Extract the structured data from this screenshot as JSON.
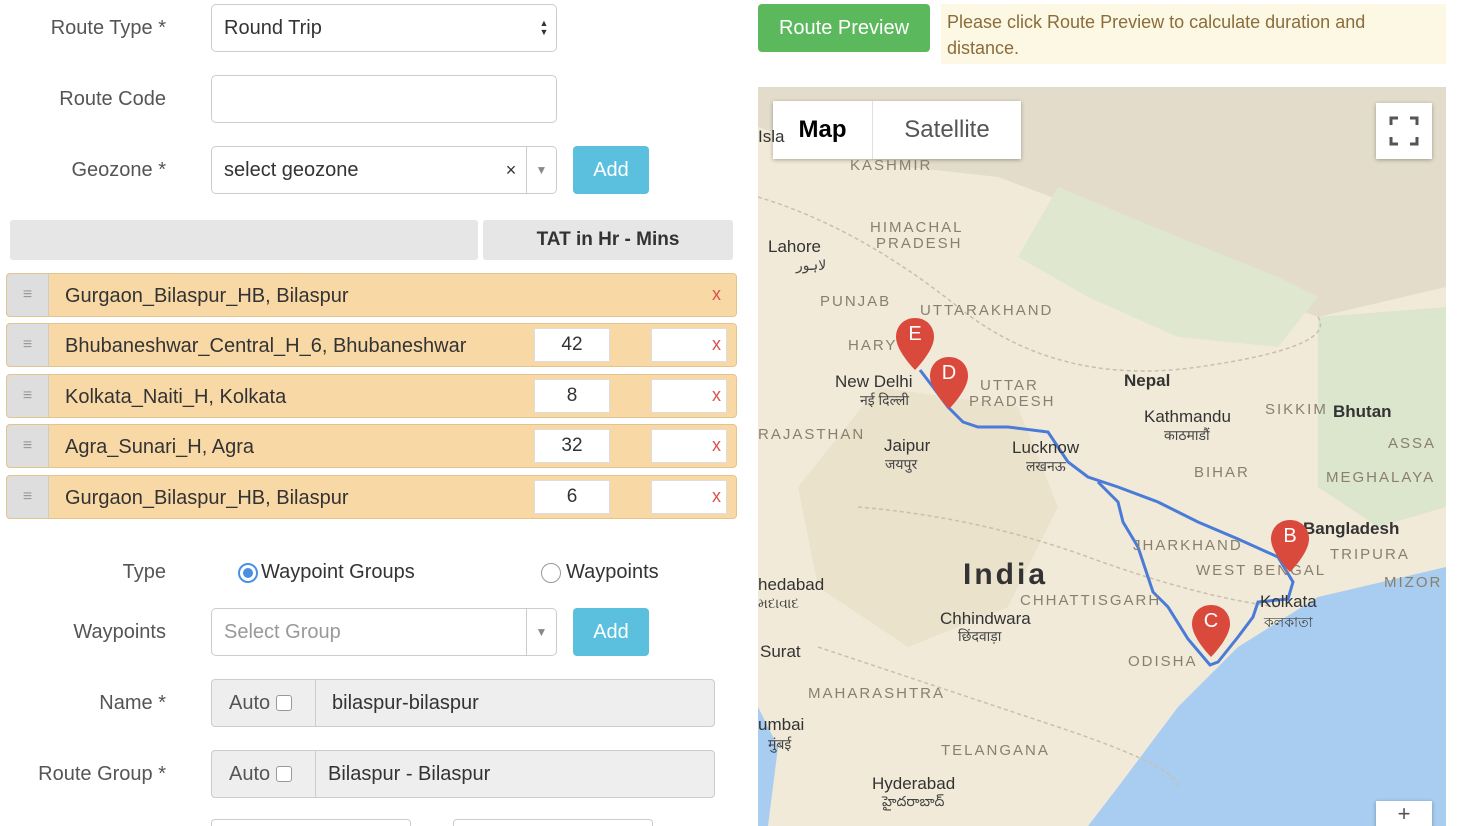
{
  "form": {
    "route_type": {
      "label": "Route Type *",
      "value": "Round Trip"
    },
    "route_code": {
      "label": "Route Code",
      "value": ""
    },
    "geozone": {
      "label": "Geozone *",
      "placeholder": "select geozone",
      "clear": "×",
      "add_label": "Add"
    },
    "table_header": {
      "tat_label": "TAT in Hr - Mins"
    },
    "waypoint_rows": [
      {
        "name": "Gurgaon_Bilaspur_HB, Bilaspur",
        "tat_hr": "",
        "remove": "x"
      },
      {
        "name": "Bhubaneshwar_Central_H_6, Bhubaneshwar",
        "tat_hr": "42",
        "remove": "x"
      },
      {
        "name": "Kolkata_Naiti_H, Kolkata",
        "tat_hr": "8",
        "remove": "x"
      },
      {
        "name": "Agra_Sunari_H, Agra",
        "tat_hr": "32",
        "remove": "x"
      },
      {
        "name": "Gurgaon_Bilaspur_HB, Bilaspur",
        "tat_hr": "6",
        "remove": "x"
      }
    ],
    "type": {
      "label": "Type",
      "options": [
        "Waypoint Groups",
        "Waypoints"
      ],
      "selected": "Waypoint Groups"
    },
    "waypoints": {
      "label": "Waypoints",
      "placeholder": "Select Group",
      "add_label": "Add"
    },
    "name": {
      "label": "Name *",
      "auto_label": "Auto",
      "value": "bilaspur-bilaspur"
    },
    "route_group": {
      "label": "Route Group *",
      "auto_label": "Auto",
      "value": "Bilaspur - Bilaspur"
    }
  },
  "route_preview": {
    "button_label": "Route Preview",
    "notice": "Please click Route Preview to calculate duration and distance."
  },
  "map": {
    "tabs": [
      "Map",
      "Satellite"
    ],
    "active_tab": "Map",
    "markers": [
      "E",
      "D",
      "B",
      "C"
    ],
    "labels": {
      "kashmir": "KASHMIR",
      "himachal1": "HIMACHAL",
      "himachal2": "PRADESH",
      "lahore": "Lahore",
      "lahore_local": "لاہور",
      "punjab": "PUNJAB",
      "uttarakhand": "UTTARAKHAND",
      "haryana": "HARY",
      "new_delhi": "New Delhi",
      "new_delhi_local": "नई दिल्ली",
      "uttar1": "UTTAR",
      "uttar2": "PRADESH",
      "nepal": "Nepal",
      "kathmandu": "Kathmandu",
      "kathmandu_local": "काठमाडौं",
      "sikkim": "SIKKIM",
      "bhutan": "Bhutan",
      "rajasthan": "RAJASTHAN",
      "jaipur": "Jaipur",
      "jaipur_local": "जयपुर",
      "lucknow": "Lucknow",
      "lucknow_local": "लखनऊ",
      "bihar": "BIHAR",
      "assam": "ASSA",
      "meghalaya": "MEGHALAYA",
      "jharkhand": "JHARKHAND",
      "bangladesh": "Bangladesh",
      "tripura": "TRIPURA",
      "west_bengal": "WEST BENGAL",
      "mizoram": "MIZOR",
      "india": "India",
      "ahmedabad": "hedabad",
      "ahmedabad_local": "મદાવાદ",
      "chhattisgarh": "CHHATTISGARH",
      "kolkata": "Kolkata",
      "kolkata_local": "কলকাতা",
      "chhindwara": "Chhindwara",
      "chhindwara_local": "छिंदवाड़ा",
      "surat": "Surat",
      "odisha": "ODISHA",
      "maharashtra": "MAHARASHTRA",
      "mumbai": "umbai",
      "mumbai_local": "मुंबई",
      "telangana": "TELANGANA",
      "hyderabad": "Hyderabad",
      "hyderabad_local": "హైదరాబాద్",
      "islamabad": "Isla",
      "zoom_in": "+"
    },
    "colors": {
      "route": "#4a7bd8",
      "marker": "#d9493c",
      "water": "#a8cdf0",
      "land": "#f1ead8"
    }
  }
}
